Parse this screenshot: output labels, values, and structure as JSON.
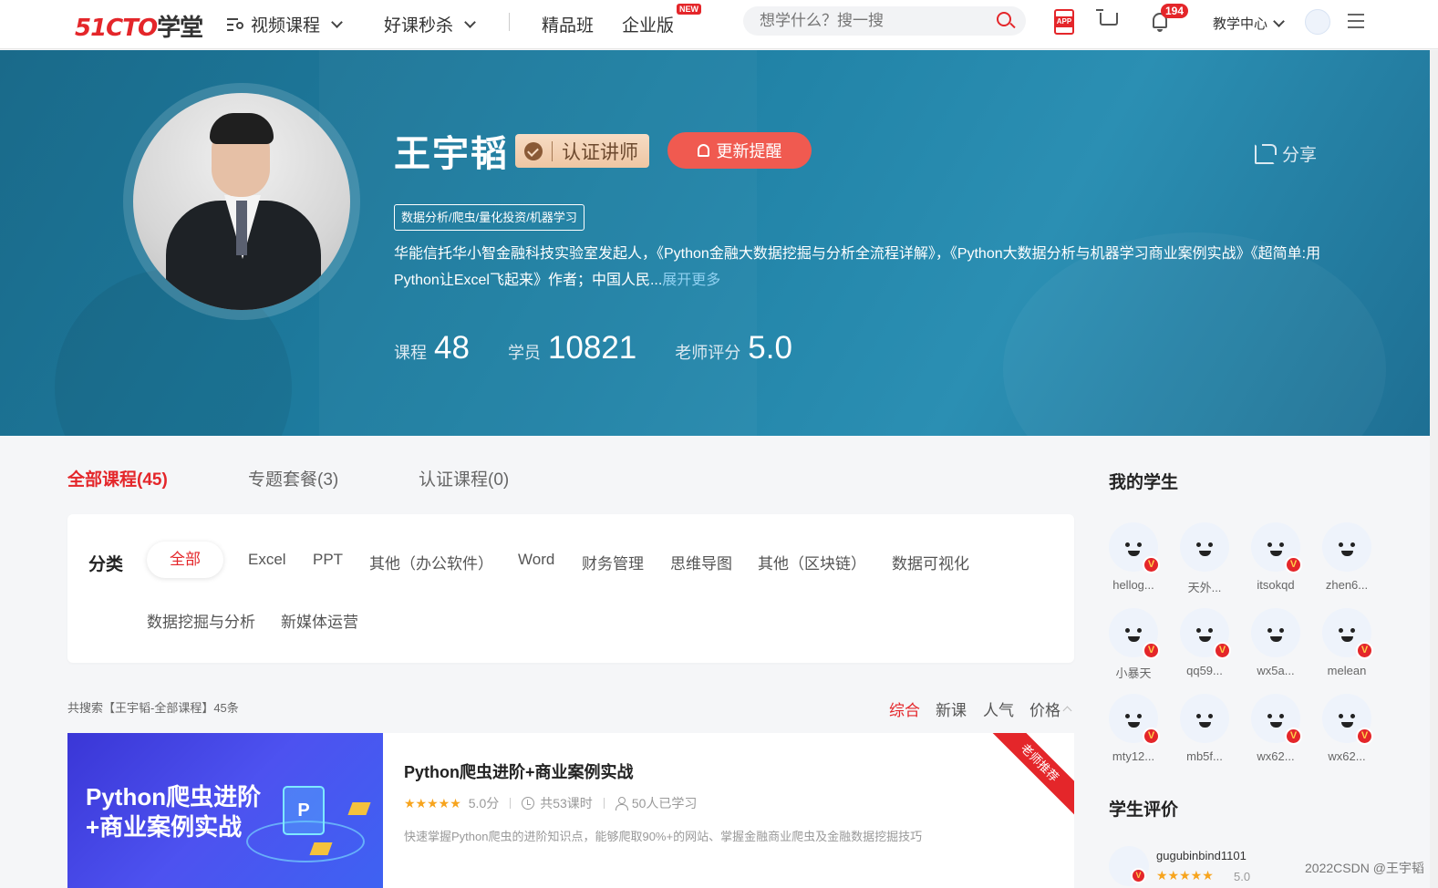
{
  "nav": {
    "logo_red": "51CTO",
    "logo_dark": "学堂",
    "video_courses": "视频课程",
    "flash_sale": "好课秒杀",
    "premium": "精品班",
    "enterprise": "企业版",
    "new_badge": "NEW",
    "search_placeholder": "想学什么？搜一搜",
    "app_label": "APP",
    "notification_count": "194",
    "teach_center": "教学中心"
  },
  "profile": {
    "name": "王宇韬",
    "cert_label": "认证讲师",
    "remind_label": "更新提醒",
    "share_label": "分享",
    "tagline": "数据分析/爬虫/量化投资/机器学习",
    "bio": "华能信托华小智金融科技实验室发起人，《Python金融大数据挖掘与分析全流程详解》，《Python大数据分析与机器学习商业案例实战》《超简单:用Python让Excel飞起来》作者；中国人民...",
    "bio_more": "展开更多",
    "stats": [
      {
        "label": "课程",
        "value": "48"
      },
      {
        "label": "学员",
        "value": "10821"
      },
      {
        "label": "老师评分",
        "value": "5.0"
      }
    ]
  },
  "tabs": [
    {
      "label": "全部课程(45)"
    },
    {
      "label": "专题套餐(3)"
    },
    {
      "label": "认证课程(0)"
    }
  ],
  "filter": {
    "title": "分类",
    "chips": [
      "全部",
      "Excel",
      "PPT",
      "其他（办公软件）",
      "Word",
      "财务管理",
      "思维导图",
      "其他（区块链）",
      "数据可视化",
      "数据挖掘与分析",
      "新媒体运营"
    ]
  },
  "results": {
    "summary": "共搜索【王宇韬-全部课程】45条",
    "sorts": [
      "综合",
      "新课",
      "人气",
      "价格"
    ]
  },
  "course": {
    "thumb_text": "Python爬虫进阶+商业案例实战",
    "thumb_cube": "P",
    "title": "Python爬虫进阶+商业案例实战",
    "stars": "★★★★★",
    "rating": "5.0分",
    "lessons": "共53课时",
    "learners": "50人已学习",
    "desc": "快速掌握Python爬虫的进阶知识点，能够爬取90%+的网站、掌握金融商业爬虫及金融数据挖掘技巧",
    "ribbon": "老师推荐"
  },
  "sidebar": {
    "students_title": "我的学生",
    "students": [
      {
        "name": "hellog...",
        "v": true
      },
      {
        "name": "天外...",
        "v": false
      },
      {
        "name": "itsokqd",
        "v": true
      },
      {
        "name": "zhen6...",
        "v": false
      },
      {
        "name": "小暴天",
        "v": true
      },
      {
        "name": "qq59...",
        "v": true
      },
      {
        "name": "wx5a...",
        "v": false
      },
      {
        "name": "melean",
        "v": true
      },
      {
        "name": "mty12...",
        "v": true
      },
      {
        "name": "mb5f...",
        "v": false
      },
      {
        "name": "wx62...",
        "v": true
      },
      {
        "name": "wx62...",
        "v": true
      }
    ],
    "reviews_title": "学生评价",
    "review": {
      "name": "gugubinbind1101",
      "stars": "★★★★★",
      "score": "5.0"
    },
    "v_mark": "V"
  },
  "watermark": "2022CSDN @王宇韬"
}
